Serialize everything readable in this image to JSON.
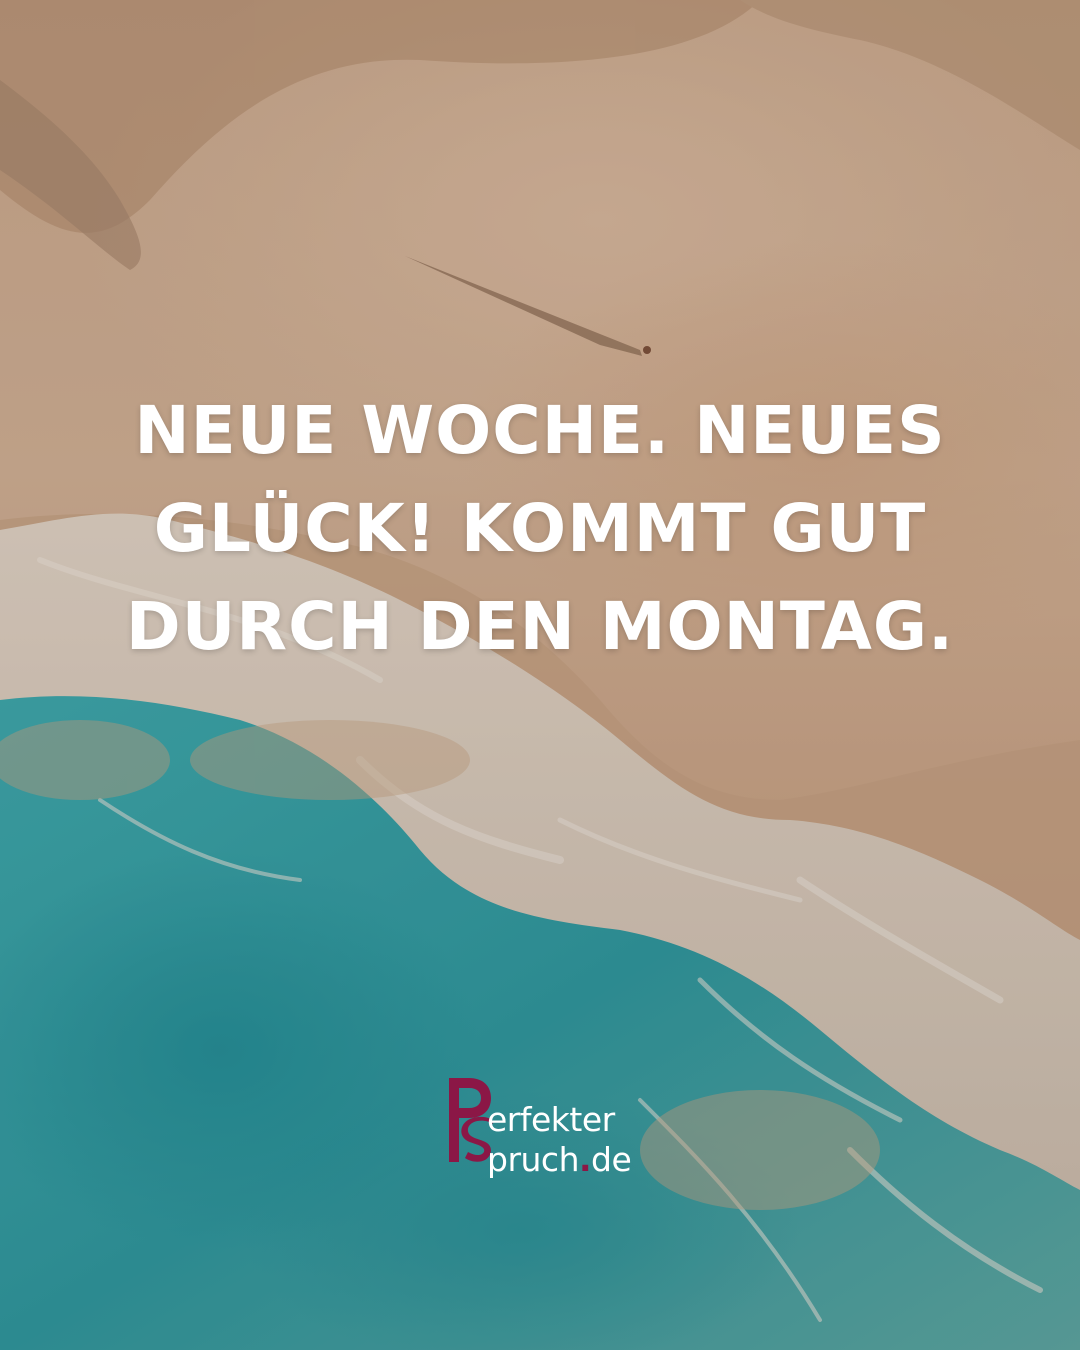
{
  "quote": {
    "lines": [
      "NEUE WOCHE. NEUES",
      "GLÜCK! KOMMT GUT",
      "DURCH DEN MONTAG."
    ]
  },
  "logo": {
    "line1": "erfekter",
    "line2": "pruch",
    "dot": ".",
    "tld": "de",
    "brand_color": "#8b1746"
  },
  "colors": {
    "sand": "#d1b196",
    "water": "#2fa0a6",
    "foam": "#e8e2d8",
    "text": "#ffffff"
  }
}
